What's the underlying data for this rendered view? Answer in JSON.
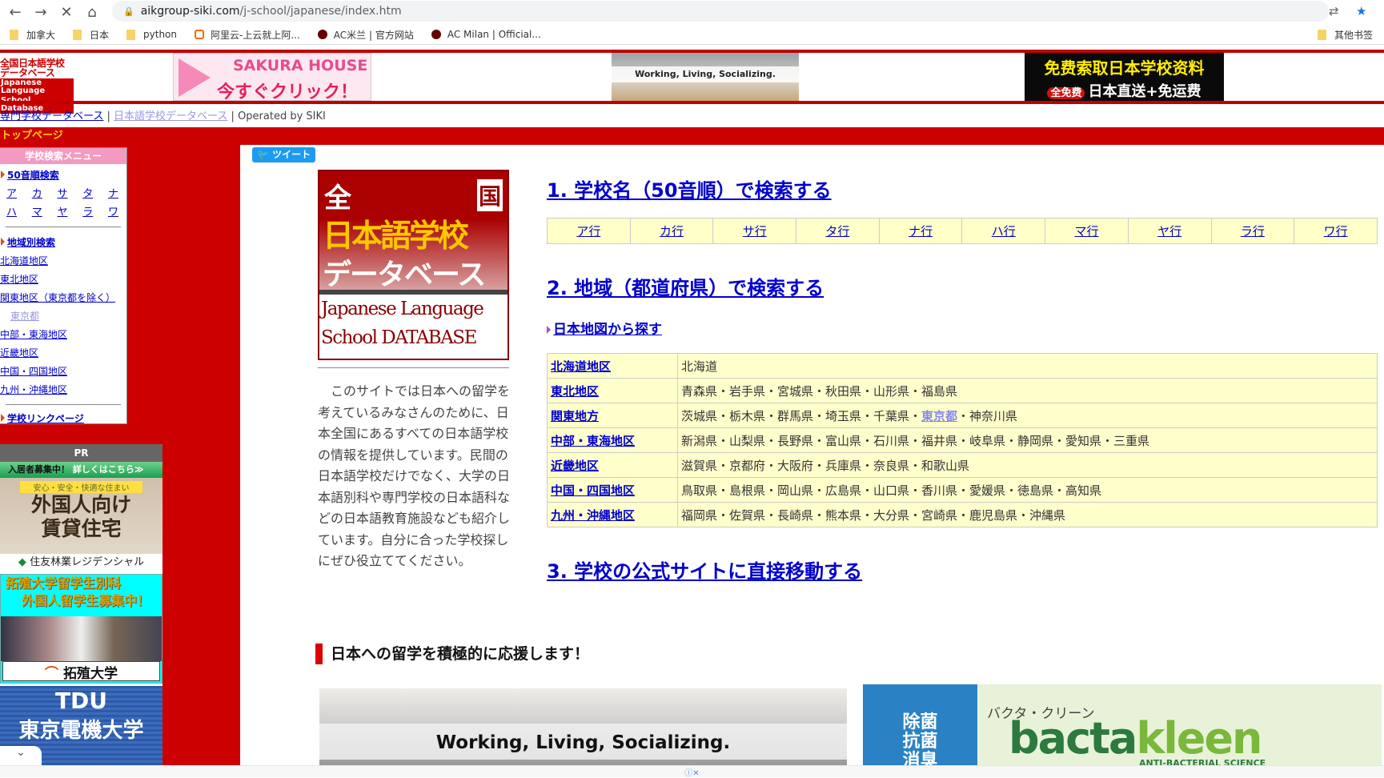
{
  "browser": {
    "url_host": "aikgroup-siki.com",
    "url_path": "/j-school/japanese/index.htm",
    "bookmarks": [
      "加拿大",
      "日本",
      "python",
      "阿里云-上云就上阿...",
      "AC米兰 | 官方网站",
      "AC Milan | Official..."
    ],
    "other_bookmarks": "其他书签"
  },
  "header": {
    "logo_jp_1": "全国日本語学校",
    "logo_jp_2": "データベース",
    "logo_en_1": "Japanese Language",
    "logo_en_2": "School Database",
    "sakura_title": "SAKURA HOUSE",
    "sakura_cta": "今すぐクリック！",
    "working_text": "Working, Living, Socializing.",
    "free_line1": "免费索取日本学校资料",
    "free_badge": "全免费",
    "free_line2": "日本直送+免运费"
  },
  "toplinks": {
    "link1": "専門学校データベース",
    "sep": "|",
    "link2": "日本語学校データベース",
    "operated": "Operated by SIKI"
  },
  "topbar": {
    "label": "トップページ"
  },
  "sidebar": {
    "title": "学校検索メニュー",
    "gojuon_label": "50音順検索",
    "kana_row1": [
      "ア",
      "カ",
      "サ",
      "タ",
      "ナ"
    ],
    "kana_row2": [
      "ハ",
      "マ",
      "ヤ",
      "ラ",
      "ワ"
    ],
    "region_label": "地域別検索",
    "regions": [
      "北海道地区",
      "東北地区",
      "関東地区（東京都を除く）",
      "東京都",
      "中部・東海地区",
      "近畿地区",
      "中国・四国地区",
      "九州・沖縄地区"
    ],
    "links_label": "学校リンクページ"
  },
  "pr": {
    "title": "PR",
    "ad1_top": "入居者募集中！",
    "ad1_more": "詳しくはこちら≫",
    "ad1_ribbon": "安心・安全・快適な住まい",
    "ad1_big1": "外国人向け",
    "ad1_big2": "賃貸住宅",
    "ad1_company": "住友林業レジデンシャル",
    "ad2_line1": "拓殖大学留学生別科",
    "ad2_line2": "外国人留学生募集中！",
    "ad2_uni": "拓殖大学",
    "ad3_abbr": "TDU",
    "ad3_name": "東京電機大学"
  },
  "main": {
    "tweet": "ツイート",
    "logo": {
      "zen": "全",
      "koku": "国",
      "nihon": "日本語学校",
      "db": "データベース",
      "en1": "Japanese Language",
      "en2": "School DATABASE"
    },
    "intro": "このサイトでは日本への留学を考えているみなさんのために、日本全国にあるすべての日本語学校の情報を提供しています。民間の日本語学校だけでなく、大学の日本語別科や専門学校の日本語科などの日本語教育施設なども紹介しています。自分に合った学校探しにぜひ役立ててください。",
    "heading1": "1. 学校名（50音順）で検索する",
    "kana_rows": [
      "ア行",
      "カ行",
      "サ行",
      "タ行",
      "ナ行",
      "ハ行",
      "マ行",
      "ヤ行",
      "ラ行",
      "ワ行"
    ],
    "heading2": "2. 地域（都道府県）で検索する",
    "map_link": "日本地図から探す",
    "regions": [
      {
        "name": "北海道地区",
        "prefs": "北海道"
      },
      {
        "name": "東北地区",
        "prefs": "青森県・岩手県・宮城県・秋田県・山形県・福島県"
      },
      {
        "name": "関東地方",
        "prefs_before": "茨城県・栃木県・群馬県・埼玉県・千葉県・",
        "tokyo": "東京都",
        "prefs_after": "・神奈川県"
      },
      {
        "name": "中部・東海地区",
        "prefs": "新潟県・山梨県・長野県・富山県・石川県・福井県・岐阜県・静岡県・愛知県・三重県"
      },
      {
        "name": "近畿地区",
        "prefs": "滋賀県・京都府・大阪府・兵庫県・奈良県・和歌山県"
      },
      {
        "name": "中国・四国地区",
        "prefs": "鳥取県・島根県・岡山県・広島県・山口県・香川県・愛媛県・徳島県・高知県"
      },
      {
        "name": "九州・沖縄地区",
        "prefs": "福岡県・佐賀県・長崎県・熊本県・大分県・宮崎県・鹿児島県・沖縄県"
      }
    ],
    "heading3": "3. 学校の公式サイトに直接移動する",
    "support": "日本への留学を積極的に応援します！",
    "banner_working": "Working, Living, Socializing.",
    "bact_side": [
      "除菌",
      "抗菌",
      "消臭"
    ],
    "bact_kana": "バクタ・クリーン",
    "bact_name_a": "bacta",
    "bact_name_b": "kleen",
    "bact_sci": "ANTI-BACTERIAL SCIENCE"
  },
  "colors": {
    "brand_red": "#cc0000",
    "link": "#0000cc",
    "table_bg": "#ffffcc",
    "topbar_text": "#ffd000"
  }
}
